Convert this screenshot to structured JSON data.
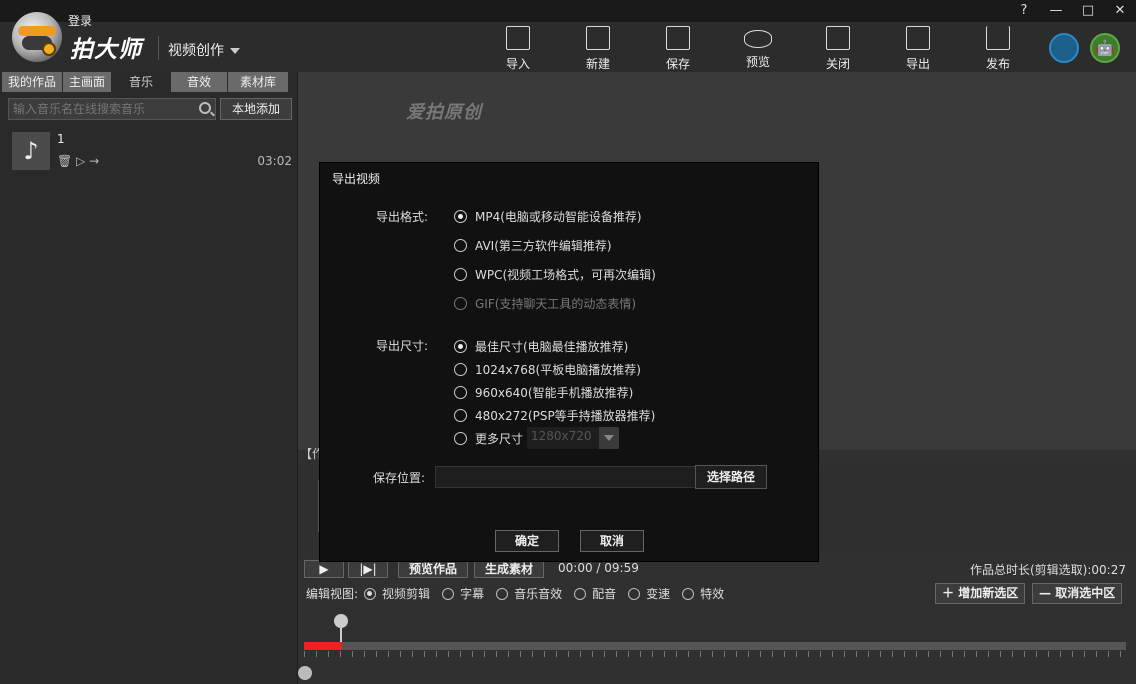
{
  "header": {
    "login": "登录",
    "app_name": "拍大师",
    "mode": "视频创作"
  },
  "window_controls": [
    "?",
    "—",
    "□",
    "✕"
  ],
  "toolbar": [
    {
      "label": "导入",
      "icon": "import-icon"
    },
    {
      "label": "新建",
      "icon": "new-icon"
    },
    {
      "label": "保存",
      "icon": "save-icon"
    },
    {
      "label": "预览",
      "icon": "preview-icon"
    },
    {
      "label": "关闭",
      "icon": "close-doc-icon"
    },
    {
      "label": "导出",
      "icon": "export-icon"
    },
    {
      "label": "发布",
      "icon": "publish-icon"
    }
  ],
  "os_buttons": {
    "ios": "",
    "android": "🤖"
  },
  "left_tabs": [
    "我的作品",
    "主画面",
    "音乐",
    "音效",
    "素材库"
  ],
  "search": {
    "placeholder": "输入音乐名在线搜索音乐",
    "local_add": "本地添加"
  },
  "music_list": [
    {
      "name": "1",
      "duration": "03:02",
      "icons": "🗑 ▷ →"
    }
  ],
  "preview": {
    "watermark": "爱拍原创"
  },
  "materials_header": "【作品素材】",
  "controls": {
    "play": "▶",
    "frame": "|▶|",
    "preview_work": "预览作品",
    "generate": "生成素材",
    "timecode": "00:00 / 09:59",
    "total": "作品总时长(剪辑选取):00:27",
    "edit_view_label": "编辑视图:",
    "views": [
      "视频剪辑",
      "字幕",
      "音乐音效",
      "配音",
      "变速",
      "特效"
    ],
    "add_selection": "增加新选区",
    "cancel_selection": "取消选中区"
  },
  "dialog": {
    "title": "导出视频",
    "format_label": "导出格式:",
    "formats": [
      {
        "label": "MP4(电脑或移动智能设备推荐)",
        "selected": true
      },
      {
        "label": "AVI(第三方软件编辑推荐)",
        "selected": false
      },
      {
        "label": "WPC(视频工场格式，可再次编辑)",
        "selected": false
      },
      {
        "label": "GIF(支持聊天工具的动态表情)",
        "selected": false,
        "disabled": true
      }
    ],
    "size_label": "导出尺寸:",
    "sizes": [
      {
        "label": "最佳尺寸(电脑最佳播放推荐)",
        "selected": true
      },
      {
        "label": "1024x768(平板电脑播放推荐)",
        "selected": false
      },
      {
        "label": "960x640(智能手机播放推荐)",
        "selected": false
      },
      {
        "label": "480x272(PSP等手持播放器推荐)",
        "selected": false
      },
      {
        "label": "更多尺寸",
        "selected": false
      }
    ],
    "more_size_value": "1280x720",
    "save_location_label": "保存位置:",
    "choose_path": "选择路径",
    "ok": "确定",
    "cancel": "取消"
  }
}
